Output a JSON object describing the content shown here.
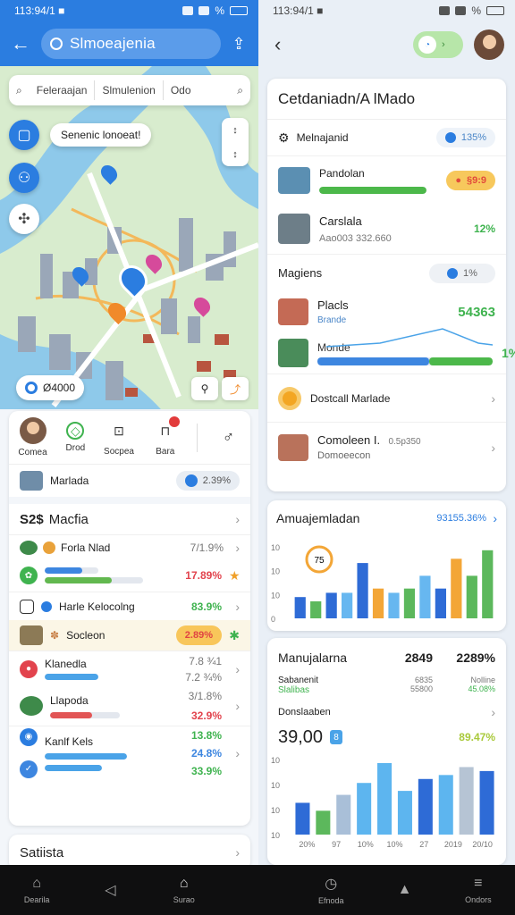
{
  "left": {
    "status": {
      "time": "113:94/1 ■",
      "battery": "%"
    },
    "header": {
      "title": "Slmoeajenia"
    },
    "filters": [
      "Feleraajan",
      "Slmulenion",
      "Odo"
    ],
    "map": {
      "tooltip": "Senenic lonoeat!",
      "price_chip": "Ø4000",
      "pins": [
        "blue",
        "blue",
        "pink",
        "orange",
        "pink",
        "blue"
      ]
    },
    "actions": [
      {
        "label": "Comea",
        "icon": "avatar"
      },
      {
        "label": "Drod",
        "icon": "pin-icon"
      },
      {
        "label": "Socpea",
        "icon": "calendar-icon"
      },
      {
        "label": "Bara",
        "icon": "bag-icon"
      }
    ],
    "summary": {
      "label": "Marlada",
      "value": "2.39%"
    },
    "section1": {
      "title": "Macfia",
      "prefix": "S2$"
    },
    "rows": [
      {
        "label": "Forla Nlad",
        "value": "7/1.9%",
        "icon_color": "#e9a23b",
        "thumb": "#3e8a4a",
        "bar": null
      },
      {
        "label": "",
        "value": "17.89%",
        "icon_color": "#3fb34f",
        "bar": {
          "fill": 0.75,
          "color": "#62b84f"
        },
        "bar2": {
          "fill": 0.4,
          "color": "#3d86e0"
        }
      },
      {
        "label": "Harle Kelocolng",
        "value": "83.9%",
        "icon_color": "#2b7de0"
      },
      {
        "label": "Socleon",
        "value": "2.89%",
        "highlight": true
      },
      {
        "label": "Klanedla",
        "value": "7.8 ¾1",
        "value2": "7.2 ¾%",
        "bar": {
          "fill": 0.55,
          "color": "#4aa3e8"
        }
      },
      {
        "label": "Llapoda",
        "value": "3/1.8%",
        "value2": "32.9%",
        "bar": {
          "fill": 0.6,
          "color": "#e25555"
        }
      },
      {
        "label": "Kanlf Kels",
        "value": "13.8%",
        "value2": "24.8%",
        "value3": "33.9%",
        "bar": {
          "fill": 0.8,
          "color": "#4aa3e8"
        },
        "bar2": {
          "fill": 0.55,
          "color": "#4aa3e8"
        }
      }
    ],
    "footer": {
      "title": "Satiista"
    }
  },
  "right": {
    "status": {
      "time": "113:94/1 ■",
      "battery": "%"
    },
    "card1": {
      "title": "Cetdaniadn/A lMado",
      "header_row": {
        "label": "Melnajanid",
        "badge": "135%"
      },
      "items": [
        {
          "label": "Pandolan",
          "badge": "§9:9",
          "bar": {
            "fill": 0.62,
            "color": "#4cb84a"
          },
          "thumb": "#5b8fb2"
        },
        {
          "label": "Carslala",
          "sub": "Aao003 332.660",
          "value": "12%",
          "thumb": "#6d7e88"
        }
      ],
      "section": {
        "label": "Magiens",
        "badge": "1%"
      },
      "items2": [
        {
          "label": "Placls",
          "sub": "Brande",
          "value": "54363",
          "thumb": "#c46a55"
        },
        {
          "label": "Monde",
          "value": "1%",
          "thumb": "#4a8c5a"
        },
        {
          "label": "Dostcall Marlade",
          "thumb": "#f3a623"
        },
        {
          "label": "Comoleen I.",
          "sub": "Domoeecon",
          "extra": "0.5p350",
          "thumb": "#b9725b"
        }
      ]
    },
    "card2": {
      "title": "Amuajemladan",
      "badge": "93155.36%",
      "chart_data": {
        "type": "bar",
        "values": [
          5,
          4,
          6,
          6,
          13,
          7,
          6,
          7,
          10,
          7,
          14,
          10,
          16
        ],
        "colors": [
          "#2e6bd6",
          "#5cb85c",
          "#2e6bd6",
          "#67b7f0",
          "#2e6bd6",
          "#f3a637",
          "#67b7f0",
          "#5cb85c",
          "#67b7f0",
          "#2e6bd6",
          "#f3a637",
          "#5cb85c",
          "#5cb85c"
        ],
        "ticks": [
          "10",
          "10",
          "10",
          "0"
        ],
        "gauge": "75"
      }
    },
    "card3": {
      "title": "Manujalarna",
      "col1": {
        "big": "2849",
        "l1": "Sabanenit",
        "l2": "Slalibas",
        "v1": "6835",
        "v2": "55800"
      },
      "col2": {
        "big": "2289%",
        "l1": "Nolline",
        "l2": "45.08%"
      },
      "sub": "Donslaaben",
      "big_value": "39,00",
      "value_badge": "8",
      "green_value": "89.47%",
      "chart_data": {
        "type": "bar",
        "values": [
          8,
          6,
          10,
          13,
          18,
          11,
          14,
          15,
          17,
          16
        ],
        "colors": [
          "#2e6bd6",
          "#5cb85c",
          "#a9bfd8",
          "#5db5ef",
          "#5db5ef",
          "#5db5ef",
          "#2e6bd6",
          "#5db5ef",
          "#b6c4d4",
          "#2e6bd6"
        ],
        "ticks": [
          "10",
          "10",
          "10",
          "10"
        ],
        "xlabels": [
          "20%",
          "97",
          "10%",
          "10%",
          "27",
          "2019",
          "20/10"
        ]
      }
    }
  },
  "nav": [
    {
      "label": "Dearila",
      "icon": "home-icon"
    },
    {
      "label": "",
      "icon": "megaphone-icon"
    },
    {
      "label": "Surao",
      "icon": "house-icon"
    },
    {
      "label": "",
      "icon": ""
    },
    {
      "label": "Efnoda",
      "icon": "clock-icon"
    },
    {
      "label": "",
      "icon": "book-icon"
    },
    {
      "label": "Ondors",
      "icon": "menu-icon"
    }
  ]
}
